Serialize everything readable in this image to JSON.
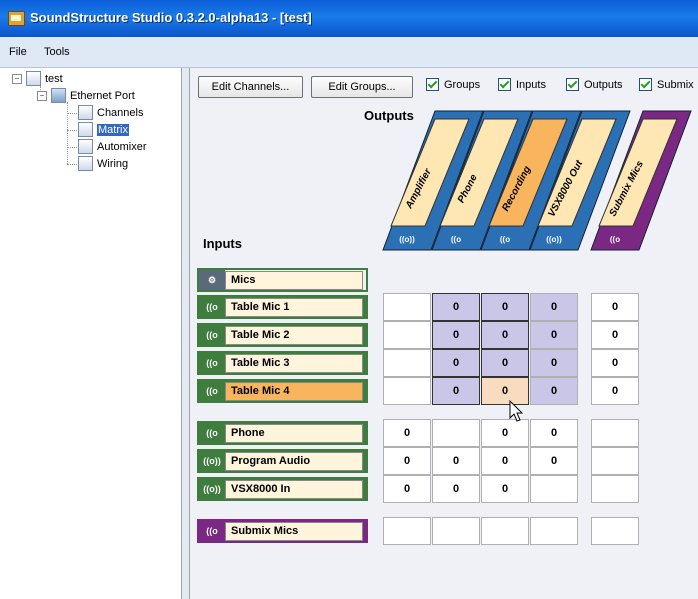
{
  "window": {
    "title": "SoundStructure Studio 0.3.2.0-alpha13 - [test]"
  },
  "menu": [
    {
      "label": "File"
    },
    {
      "label": "Tools"
    }
  ],
  "tree": {
    "root": "test",
    "port": "Ethernet Port",
    "items": [
      "Channels",
      "Matrix",
      "Automixer",
      "Wiring"
    ],
    "selected": "Matrix"
  },
  "toolbar": {
    "edit_channels": "Edit Channels...",
    "edit_groups": "Edit Groups...",
    "checkboxes": [
      {
        "label": "Groups",
        "checked": true
      },
      {
        "label": "Inputs",
        "checked": true
      },
      {
        "label": "Outputs",
        "checked": true
      },
      {
        "label": "Submix",
        "checked": true
      }
    ]
  },
  "matrix": {
    "outputs_label": "Outputs",
    "inputs_label": "Inputs",
    "columns": [
      {
        "label": "Amplifier",
        "color": "#ffe7b3",
        "icon": "((o))"
      },
      {
        "label": "Phone",
        "color": "#ffe7b3",
        "icon": "((o"
      },
      {
        "label": "Recording",
        "color": "#f8b55d",
        "icon": "((o"
      },
      {
        "label": "VSX8000 Out",
        "color": "#ffe7b3",
        "icon": "((o))"
      },
      {
        "label": "Submix Mics",
        "color": "#ffe7b3",
        "icon": "((o",
        "submix": true
      }
    ],
    "group": {
      "label": "Mics",
      "icon": "gear"
    },
    "rows": [
      {
        "label": "Table Mic 1",
        "icon": "((o",
        "type": "mic",
        "cells": [
          "",
          "0",
          "0",
          "0",
          "0"
        ]
      },
      {
        "label": "Table Mic 2",
        "icon": "((o",
        "type": "mic",
        "cells": [
          "",
          "0",
          "0",
          "0",
          "0"
        ]
      },
      {
        "label": "Table Mic 3",
        "icon": "((o",
        "type": "mic",
        "cells": [
          "",
          "0",
          "0",
          "0",
          "0"
        ]
      },
      {
        "label": "Table Mic 4",
        "icon": "((o",
        "type": "mic",
        "highlight": true,
        "cells": [
          "",
          "0",
          "0",
          "0",
          "0"
        ]
      },
      {
        "label": "Phone",
        "icon": "((o",
        "type": "line",
        "cells": [
          "0",
          "",
          "0",
          "0",
          ""
        ]
      },
      {
        "label": "Program Audio",
        "icon": "((o))",
        "type": "line",
        "cells": [
          "0",
          "0",
          "0",
          "0",
          ""
        ]
      },
      {
        "label": "VSX8000 In",
        "icon": "((o))",
        "type": "line",
        "cells": [
          "0",
          "0",
          "0",
          "",
          ""
        ]
      },
      {
        "label": "Submix Mics",
        "icon": "((o",
        "type": "submix",
        "cells": [
          "",
          "",
          "",
          "",
          ""
        ]
      }
    ]
  },
  "colors": {
    "mic_group_border": "#3e7d3e",
    "submix": "#7b2784",
    "mic_cell": "#c9c6e8",
    "highlight_cell": "#f9dcc0",
    "column_stripe": "#2b6fb5"
  }
}
